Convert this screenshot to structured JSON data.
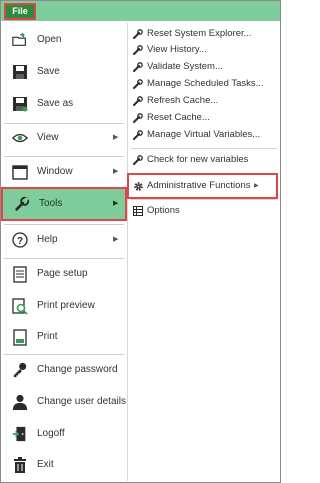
{
  "file_label": "File",
  "left_menu": {
    "items": [
      {
        "label": "Open",
        "icon": "open-folder-icon"
      },
      {
        "label": "Save",
        "icon": "save-disk-icon"
      },
      {
        "label": "Save as",
        "icon": "save-as-disk-icon"
      },
      {
        "label": "View",
        "icon": "eye-icon"
      },
      {
        "label": "Window",
        "icon": "window-icon"
      },
      {
        "label": "Tools",
        "icon": "wrench-icon"
      },
      {
        "label": "Help",
        "icon": "help-icon"
      },
      {
        "label": "Page setup",
        "icon": "page-setup-icon"
      },
      {
        "label": "Print preview",
        "icon": "print-preview-icon"
      },
      {
        "label": "Print",
        "icon": "print-icon"
      },
      {
        "label": "Change password",
        "icon": "key-icon"
      },
      {
        "label": "Change user details",
        "icon": "user-icon"
      },
      {
        "label": "Logoff",
        "icon": "logoff-door-icon"
      },
      {
        "label": "Exit",
        "icon": "exit-trash-icon"
      }
    ]
  },
  "tools_submenu": {
    "items": [
      {
        "label": "Reset System Explorer..."
      },
      {
        "label": "View History..."
      },
      {
        "label": "Validate System..."
      },
      {
        "label": "Manage Scheduled Tasks..."
      },
      {
        "label": "Refresh Cache..."
      },
      {
        "label": "Reset Cache..."
      },
      {
        "label": "Manage Virtual Variables..."
      },
      {
        "label": "Check for new variables"
      },
      {
        "label": "Administrative Functions"
      },
      {
        "label": "Options"
      }
    ]
  },
  "colors": {
    "accent": "#7fcc9c",
    "file_button": "#2e8b3e",
    "highlight_border": "#e0454b"
  }
}
